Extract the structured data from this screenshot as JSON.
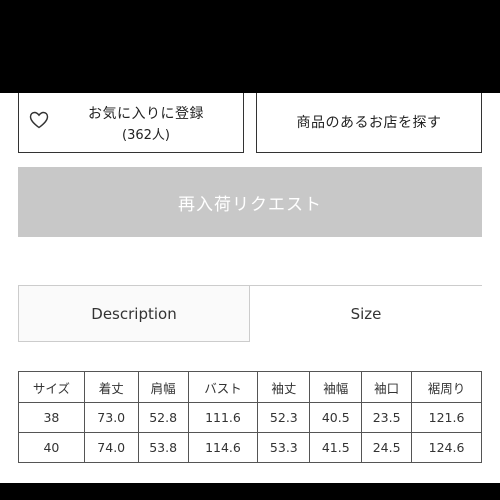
{
  "favorite": {
    "label": "お気に入りに登録",
    "count": "(362人)",
    "icon": "heart-outline-icon"
  },
  "store_button": {
    "label": "商品のあるお店を探す"
  },
  "restock_button": {
    "label": "再入荷リクエスト"
  },
  "tabs": [
    {
      "label": "Description"
    },
    {
      "label": "Size"
    }
  ],
  "size_table": {
    "headers": [
      "サイズ",
      "着丈",
      "肩幅",
      "バスト",
      "袖丈",
      "袖幅",
      "袖口",
      "裾周り"
    ],
    "rows": [
      [
        "38",
        "73.0",
        "52.8",
        "111.6",
        "52.3",
        "40.5",
        "23.5",
        "121.6"
      ],
      [
        "40",
        "74.0",
        "53.8",
        "114.6",
        "53.3",
        "41.5",
        "24.5",
        "124.6"
      ]
    ]
  }
}
